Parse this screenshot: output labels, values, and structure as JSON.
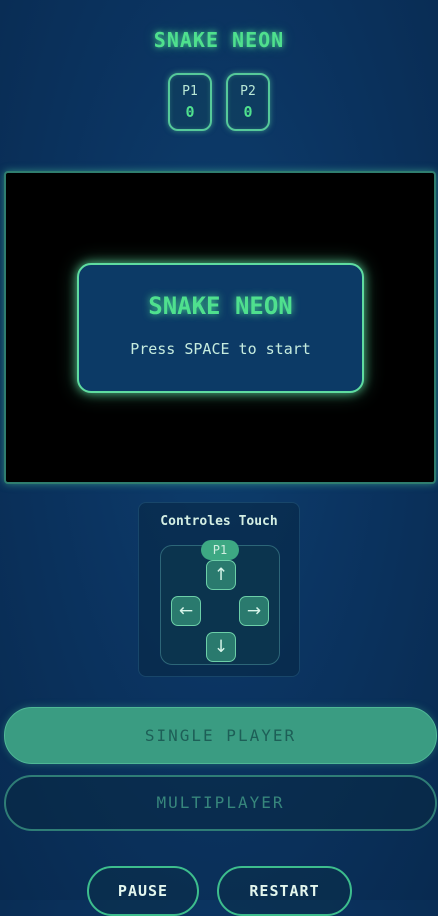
{
  "header": {
    "title": "SNAKE NEON"
  },
  "scores": [
    {
      "label": "P1",
      "value": "0"
    },
    {
      "label": "P2",
      "value": "0"
    }
  ],
  "game": {
    "overlay_title": "SNAKE NEON",
    "overlay_message": "Press SPACE to start"
  },
  "touch_controls": {
    "title": "Controles Touch",
    "player_badge": "P1",
    "up": "↑",
    "left": "←",
    "right": "→",
    "down": "↓"
  },
  "buttons": {
    "single_player": "SINGLE PLAYER",
    "multiplayer": "MULTIPLAYER",
    "pause": "PAUSE",
    "restart": "RESTART"
  },
  "colors": {
    "accent": "#4fe08e",
    "background": "#0b3461",
    "game_area": "#000000",
    "button_fill": "#3a9c82"
  }
}
